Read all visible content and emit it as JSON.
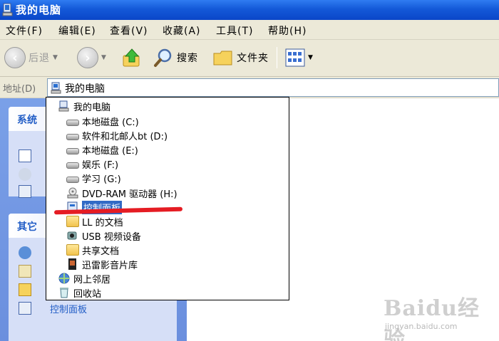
{
  "window": {
    "title": "我的电脑"
  },
  "menu": [
    "文件(F)",
    "编辑(E)",
    "查看(V)",
    "收藏(A)",
    "工具(T)",
    "帮助(H)"
  ],
  "toolbar": {
    "back": "后退",
    "search": "搜索",
    "folders": "文件夹"
  },
  "address": {
    "label": "地址(D)",
    "value": "我的电脑"
  },
  "left_pane": {
    "system_tasks_title": "系统",
    "other_places_title": "其它",
    "control_panel_link": "控制面板"
  },
  "dropdown": {
    "items": [
      "我的电脑",
      "本地磁盘 (C:)",
      "软件和北邮人bt (D:)",
      "本地磁盘 (E:)",
      "娱乐 (F:)",
      "学习 (G:)",
      "DVD-RAM 驱动器 (H:)",
      "控制面板",
      "LL 的文档",
      "USB 视频设备",
      "共享文档",
      "迅雷影音片库",
      "网上邻居",
      "回收站"
    ]
  },
  "watermark": {
    "brand": "Baidu经验",
    "url": "jingyan.baidu.com"
  },
  "colors": {
    "titlebar": "#0a46c8",
    "selection": "#316ac5",
    "annotation_red": "#e51c23"
  }
}
